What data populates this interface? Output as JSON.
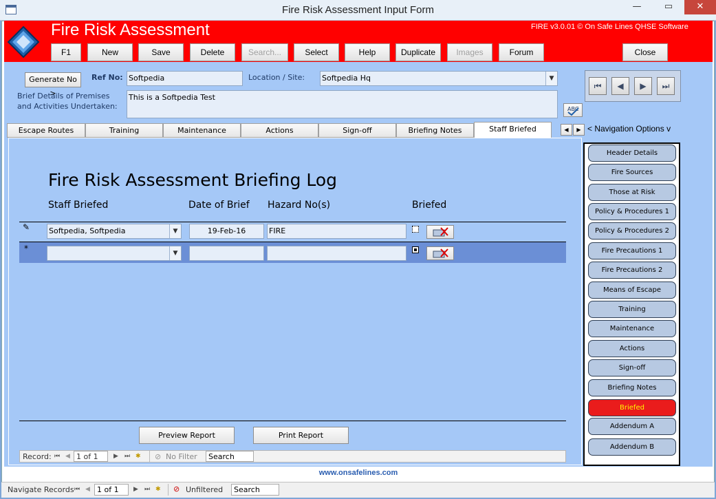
{
  "window": {
    "title": "Fire Risk Assessment Input Form",
    "close_glyph": "✕",
    "max_glyph": "▭",
    "min_glyph": "—"
  },
  "header": {
    "title": "Fire Risk Assessment",
    "version": "FIRE v3.0.01 © On Safe Lines QHSE Software",
    "accent_color": "#ff0000"
  },
  "toolbar": {
    "f1": "F1",
    "new": "New",
    "save": "Save",
    "delete": "Delete",
    "search": "Search...",
    "select": "Select",
    "help": "Help",
    "duplicate": "Duplicate",
    "images": "Images",
    "forum": "Forum",
    "close": "Close"
  },
  "form": {
    "generate_label": "Generate No >",
    "ref_label": "Ref No:",
    "ref_value": "Softpedia",
    "location_label": "Location / Site:",
    "location_value": "Softpedia Hq",
    "details_label_1": "Brief Details of Premises",
    "details_label_2": "and Activities Undertaken:",
    "details_value": "This is a Softpedia Test"
  },
  "nav": {
    "first": "⏮",
    "prev": "◀",
    "next": "▶",
    "last": "⏭",
    "options": "< Navigation Options v",
    "scroll_left": "◀",
    "scroll_right": "▶"
  },
  "tabs": [
    "Escape Routes",
    "Training",
    "Maintenance",
    "Actions",
    "Sign-off",
    "Briefing Notes",
    "Staff Briefed"
  ],
  "log": {
    "title": "Fire Risk Assessment Briefing Log",
    "columns": [
      "Staff Briefed",
      "Date of Brief",
      "Hazard No(s)",
      "Briefed"
    ],
    "rows": [
      {
        "selector": "✎",
        "staff": "Softpedia, Softpedia",
        "date": "19-Feb-16",
        "hazard": "FIRE",
        "briefed": false
      },
      {
        "selector": "*",
        "staff": "",
        "date": "",
        "hazard": "",
        "briefed": true
      }
    ],
    "preview": "Preview Report",
    "print": "Print Report"
  },
  "record_bar": {
    "label": "Record:",
    "position": "1 of 1",
    "filter": "No Filter",
    "search": "Search"
  },
  "sidebar": {
    "items": [
      "Header Details",
      "Fire Sources",
      "Those at Risk",
      "Policy & Procedures 1",
      "Policy & Procedures 2",
      "Fire Precautions 1",
      "Fire Precautions 2",
      "Means of Escape",
      "Training",
      "Maintenance",
      "Actions",
      "Sign-off",
      "Briefing Notes",
      "Briefed",
      "Addendum A",
      "Addendum B"
    ],
    "active_index": 13
  },
  "footer": {
    "url": "www.onsafelines.com"
  },
  "statusbar": {
    "label": "Navigate Records",
    "position": "1 of 1",
    "filter": "Unfiltered",
    "search": "Search"
  }
}
